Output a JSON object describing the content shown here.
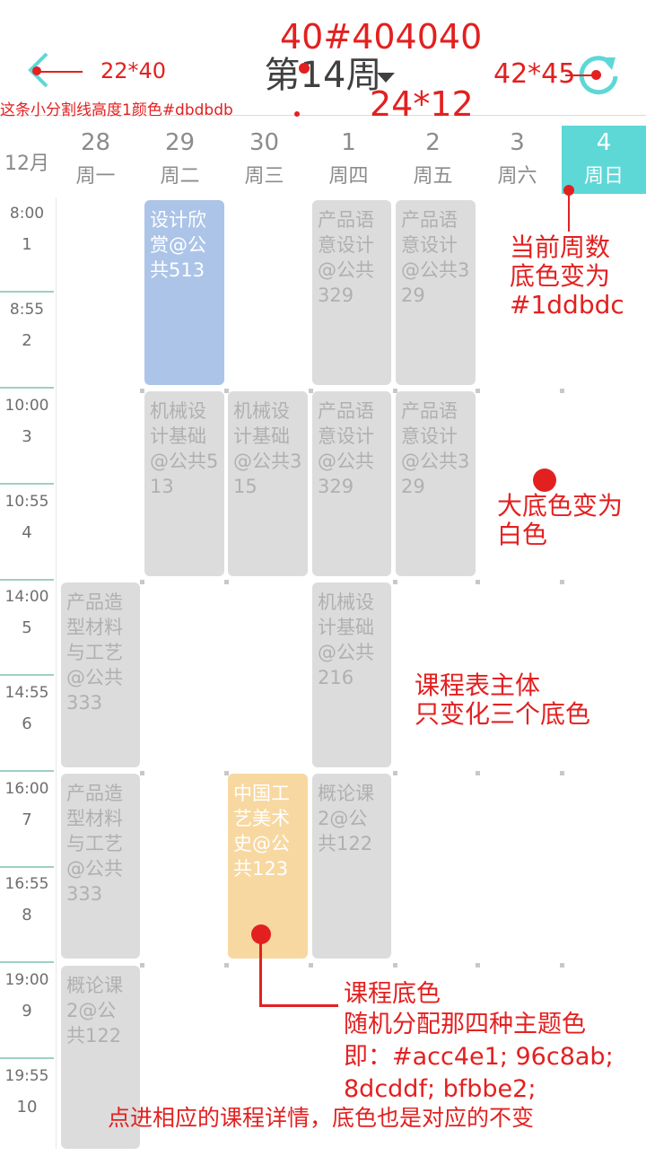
{
  "header": {
    "title_prefix": "第1",
    "title_suffix": "4周",
    "back_icon": "chevron-left-icon",
    "refresh_icon": "refresh-icon",
    "dropdown_icon": "triangle-down-icon",
    "accent": "#1ddbdc"
  },
  "month_label": "12月",
  "days": [
    {
      "num": "28",
      "name": "周一"
    },
    {
      "num": "29",
      "name": "周二"
    },
    {
      "num": "30",
      "name": "周三"
    },
    {
      "num": "1",
      "name": "周四"
    },
    {
      "num": "2",
      "name": "周五"
    },
    {
      "num": "3",
      "name": "周六"
    },
    {
      "num": "4",
      "name": "周日"
    }
  ],
  "slots": [
    {
      "time": "8:00",
      "num": "1"
    },
    {
      "time": "8:55",
      "num": "2"
    },
    {
      "time": "10:00",
      "num": "3"
    },
    {
      "time": "10:55",
      "num": "4"
    },
    {
      "time": "14:00",
      "num": "5"
    },
    {
      "time": "14:55",
      "num": "6"
    },
    {
      "time": "16:00",
      "num": "7"
    },
    {
      "time": "16:55",
      "num": "8"
    },
    {
      "time": "19:00",
      "num": "9"
    },
    {
      "time": "19:55",
      "num": "10"
    }
  ],
  "courses": [
    {
      "text": "设计欣赏@公共513",
      "style": "blue"
    },
    {
      "text": "产品语意设计@公共329",
      "style": "gray"
    },
    {
      "text": "产品语意设计@公共329",
      "style": "gray"
    },
    {
      "text": "机械设计基础@公共513",
      "style": "gray"
    },
    {
      "text": "机械设计基础@公共315",
      "style": "gray"
    },
    {
      "text": "产品语意设计@公共329",
      "style": "gray"
    },
    {
      "text": "产品语意设计@公共329",
      "style": "gray"
    },
    {
      "text": "产品造型材料与工艺@公共333",
      "style": "gray"
    },
    {
      "text": "机械设计基础@公共216",
      "style": "gray"
    },
    {
      "text": "产品造型材料与工艺@公共333",
      "style": "gray"
    },
    {
      "text": "中国工艺美术史@公共123",
      "style": "orange"
    },
    {
      "text": "概论课2@公共122",
      "style": "gray"
    },
    {
      "text": "概论课2@公共122",
      "style": "gray"
    }
  ],
  "annotations": {
    "title_spec": "40#404040",
    "back_size": "22*40",
    "refresh_size": "42*45",
    "divider_note": "这条小分割线高度1颜色#dbdbdb",
    "dropdown_size": "24*12",
    "current_week": [
      "当前周数",
      "底色变为",
      "#1ddbdc"
    ],
    "bg_white": [
      "大底色变为",
      "白色"
    ],
    "main_body": [
      "课程表主体",
      "只变化三个底色"
    ],
    "course_color": [
      "课程底色",
      "随机分配那四种主题色",
      "即：#acc4e1; 96c8ab;",
      "8dcddf; bfbbe2;",
      "点进相应的课程详情，底色也是对应的不变"
    ]
  }
}
